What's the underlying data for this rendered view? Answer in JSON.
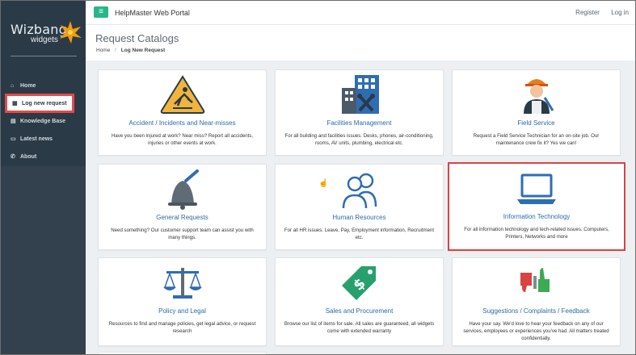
{
  "brand": {
    "name": "Wizbang",
    "sub": "widgets"
  },
  "sidebar": {
    "items": [
      {
        "label": "Home",
        "icon": "home-icon",
        "glyph": "⌂"
      },
      {
        "label": "Log new request",
        "icon": "grid-icon",
        "glyph": "▦"
      },
      {
        "label": "Knowledge Base",
        "icon": "book-icon",
        "glyph": "▤"
      },
      {
        "label": "Latest news",
        "icon": "news-icon",
        "glyph": "▭"
      },
      {
        "label": "About",
        "icon": "phone-icon",
        "glyph": "✆"
      }
    ]
  },
  "topbar": {
    "menu_glyph": "≡",
    "title": "HelpMaster Web Portal",
    "register": "Register",
    "login": "Log in"
  },
  "page": {
    "title": "Request Catalogs",
    "breadcrumb": {
      "home": "Home",
      "sep": "/",
      "current": "Log New Request"
    }
  },
  "cards": [
    {
      "title": "Accident / Incidents and Near-misses",
      "desc": "Have you been injured at work? Near miss? Report all accidents, injuries or other events at work.",
      "icon": "warning-sign-icon"
    },
    {
      "title": "Facilities Management",
      "desc": "For all building and facilities issues. Desks, phones, air-conditioning, rooms, AV units, plumbing, electrical etc.",
      "icon": "building-tools-icon"
    },
    {
      "title": "Field Service",
      "desc": "Request a Field Service Technician for an on-site job. Our maintenance crew fix it? Yes we can!",
      "icon": "technician-icon"
    },
    {
      "title": "General Requests",
      "desc": "Need something? Our customer support team can assist you with many things.",
      "icon": "bell-icon"
    },
    {
      "title": "Human Resources",
      "desc": "For all HR issues. Leave, Pay, Employment information, Recruitment etc.",
      "icon": "people-icon"
    },
    {
      "title": "Information Technology",
      "desc": "For all information technology and tech-related issues. Computers, Printers, Networks and more",
      "icon": "laptop-icon"
    },
    {
      "title": "Policy and Legal",
      "desc": "Resources to find and manage policies, get legal advice, or request research",
      "icon": "scales-icon"
    },
    {
      "title": "Sales and Procurement",
      "desc": "Browse our list of items for sale. All sales are guaranteed, all widgets come with extended warranty",
      "icon": "price-tag-icon"
    },
    {
      "title": "Suggestions / Complaints / Feedback",
      "desc": "Have your say. We'd love to hear your feedback on any of our services, employees or experiences you've had. All matters treated confidentially.",
      "icon": "thumbs-icon"
    }
  ],
  "colors": {
    "sidebar": "#2b3a47",
    "accent": "#27b589",
    "link": "#2d6aa8",
    "highlight": "#d94343"
  }
}
